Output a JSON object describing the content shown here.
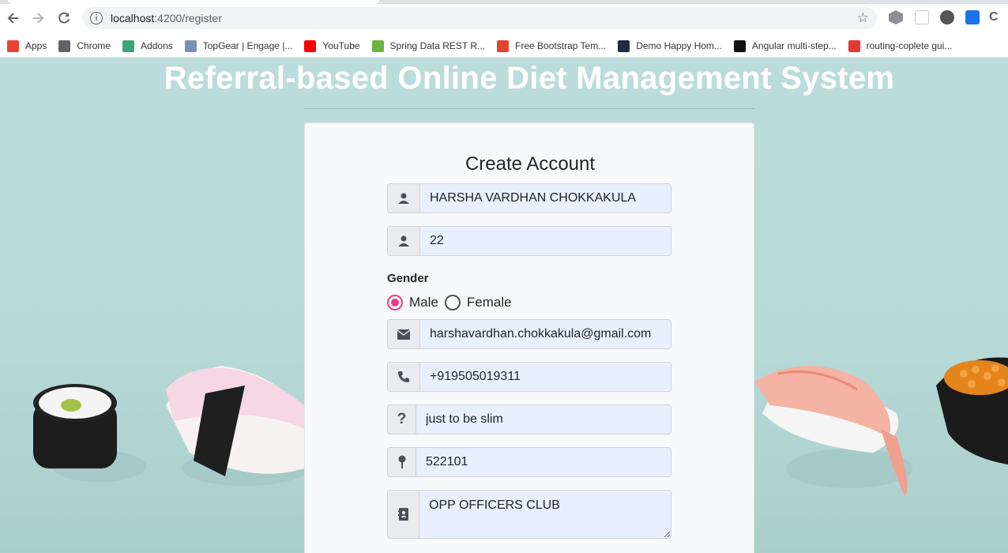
{
  "browser": {
    "url_host": "localhost",
    "url_path": ":4200/register",
    "bookmarks": [
      {
        "label": "Apps",
        "icon": "apps-grid-icon",
        "color": "#e94235"
      },
      {
        "label": "Chrome",
        "icon": "globe-icon",
        "color": "#5f6368"
      },
      {
        "label": "Addons",
        "icon": "puzzle-icon",
        "color": "#3aa57a"
      },
      {
        "label": "TopGear | Engage |...",
        "icon": "topgear-icon",
        "color": "#7a8fb8"
      },
      {
        "label": "YouTube",
        "icon": "youtube-icon",
        "color": "#ff0000"
      },
      {
        "label": "Spring Data REST R...",
        "icon": "spring-icon",
        "color": "#6db33f"
      },
      {
        "label": "Free Bootstrap Tem...",
        "icon": "s-logo-icon",
        "color": "#e0452d"
      },
      {
        "label": "Demo Happy Hom...",
        "icon": "w3-icon",
        "color": "#1f2a44"
      },
      {
        "label": "Angular multi-step...",
        "icon": "g-logo-icon",
        "color": "#111111"
      },
      {
        "label": "routing-coplete gui...",
        "icon": "routing-icon",
        "color": "#e53935"
      }
    ]
  },
  "page": {
    "site_title": "Referral-based Online Diet Management System",
    "form": {
      "title": "Create Account",
      "name_value": "HARSHA VARDHAN CHOKKAKULA",
      "age_value": "22",
      "gender_label": "Gender",
      "gender_options": [
        "Male",
        "Female"
      ],
      "gender_selected": "Male",
      "email_value": "harshavardhan.chokkakula@gmail.com",
      "phone_value": "+919505019311",
      "reason_value": "just to be slim",
      "pincode_value": "522101",
      "address_value": "OPP OFFICERS CLUB"
    }
  },
  "colors": {
    "accent_radio": "#e83e8c",
    "page_bg": "#b6d8d6",
    "input_bg": "#e8f0fe"
  }
}
